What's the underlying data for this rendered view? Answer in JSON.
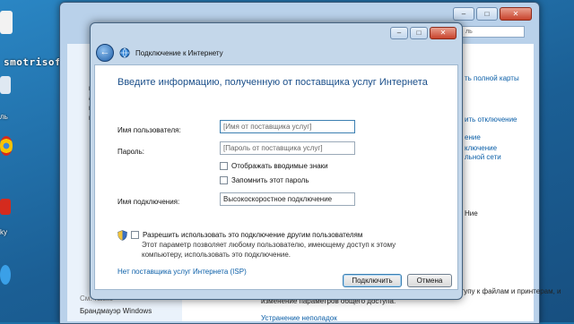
{
  "desktop": {
    "watermark": "smotrisoft.ru",
    "icon_labels": [
      "ль",
      "ky"
    ],
    "icon_colors": [
      "#f2f2f2",
      "#dfe8f2",
      "#f7c300",
      "#d42b1e",
      "#3aa0e8"
    ]
  },
  "control_panel": {
    "search_placeholder": "ль",
    "left_fragments": [
      "в",
      "ад",
      "из",
      "в"
    ],
    "right_fragments": [
      {
        "text": "ть полной карты",
        "type": "link"
      },
      {
        "text": "ить отключение",
        "type": "link"
      },
      {
        "text": "ение",
        "type": "link"
      },
      {
        "text": "ключение",
        "type": "link"
      },
      {
        "text": "льной сети",
        "type": "link"
      },
      {
        "text": "Ние",
        "type": "text"
      }
    ],
    "see_also": "См. также",
    "firewall": "Брандмауэр Windows",
    "bottom_text": "бщему доступу к файлам и принтерам, и",
    "bottom_text2": "изменение параметров общего доступа.",
    "troubleshoot": "Устранение неполадок"
  },
  "dialog": {
    "title": "Подключение к Интернету",
    "heading": "Введите информацию, полученную от поставщика услуг Интернета",
    "username_label": "Имя пользователя:",
    "username_placeholder": "[Имя от поставщика услуг]",
    "password_label": "Пароль:",
    "password_placeholder": "[Пароль от поставщика услуг]",
    "show_chars": "Отображать вводимые знаки",
    "remember_password": "Запомнить этот пароль",
    "connection_name_label": "Имя подключения:",
    "connection_name_value": "Высокоскоростное подключение",
    "allow_others": "Разрешить использовать это подключение другим пользователям",
    "allow_desc": "Этот параметр позволяет любому пользователю, имеющему доступ к этому компьютеру, использовать это подключение.",
    "no_isp_link": "Нет поставщика услуг Интернета (ISP)",
    "connect_button": "Подключить",
    "cancel_button": "Отмена",
    "caption_buttons": [
      "–",
      "□",
      "✕"
    ]
  }
}
